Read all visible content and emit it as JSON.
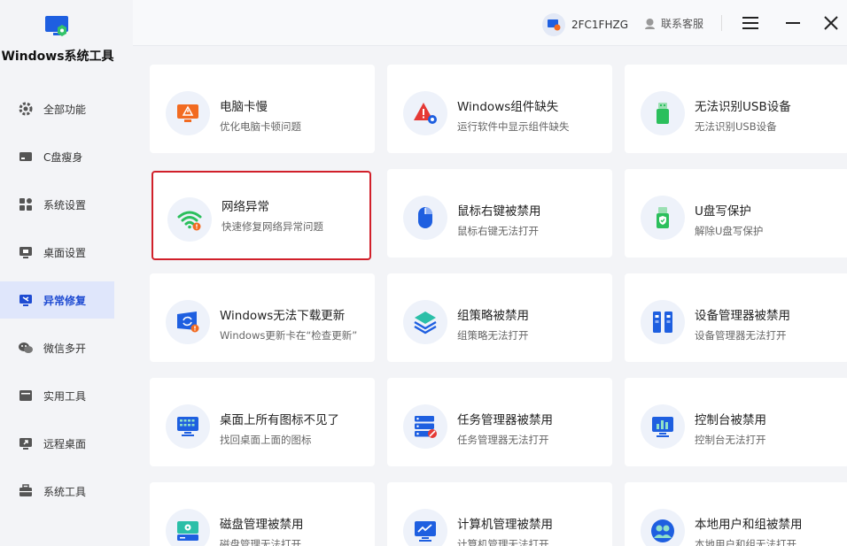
{
  "app": {
    "title": "Windows系统工具"
  },
  "sidebar": {
    "items": [
      {
        "label": "全部功能",
        "icon": "gear-icon"
      },
      {
        "label": "C盘瘦身",
        "icon": "drive-icon"
      },
      {
        "label": "系统设置",
        "icon": "grid-icon"
      },
      {
        "label": "桌面设置",
        "icon": "monitor-icon"
      },
      {
        "label": "异常修复",
        "icon": "repair-icon",
        "active": true
      },
      {
        "label": "微信多开",
        "icon": "wechat-icon"
      },
      {
        "label": "实用工具",
        "icon": "toolbox-icon"
      },
      {
        "label": "远程桌面",
        "icon": "remote-icon"
      },
      {
        "label": "系统工具",
        "icon": "briefcase-icon"
      }
    ]
  },
  "header": {
    "user_id": "2FC1FHZG",
    "support_label": "联系客服"
  },
  "cards": [
    {
      "title": "电脑卡慢",
      "desc": "优化电脑卡顿问题",
      "icon": "slow-pc-icon"
    },
    {
      "title": "Windows组件缺失",
      "desc": "运行软件中显示组件缺失",
      "icon": "component-warning-icon"
    },
    {
      "title": "无法识别USB设备",
      "desc": "无法识别USB设备",
      "icon": "usb-icon"
    },
    {
      "title": "网络异常",
      "desc": "快速修复网络异常问题",
      "icon": "wifi-warning-icon",
      "highlight": true
    },
    {
      "title": "鼠标右键被禁用",
      "desc": "鼠标右键无法打开",
      "icon": "mouse-icon"
    },
    {
      "title": "U盘写保护",
      "desc": "解除U盘写保护",
      "icon": "usb-shield-icon"
    },
    {
      "title": "Windows无法下载更新",
      "desc": "Windows更新卡在“检查更新”",
      "icon": "update-icon"
    },
    {
      "title": "组策略被禁用",
      "desc": "组策略无法打开",
      "icon": "layers-icon"
    },
    {
      "title": "设备管理器被禁用",
      "desc": "设备管理器无法打开",
      "icon": "device-manager-icon"
    },
    {
      "title": "桌面上所有图标不见了",
      "desc": "找回桌面上面的图标",
      "icon": "desktop-icons-icon"
    },
    {
      "title": "任务管理器被禁用",
      "desc": "任务管理器无法打开",
      "icon": "task-manager-icon"
    },
    {
      "title": "控制台被禁用",
      "desc": "控制台无法打开",
      "icon": "console-icon"
    },
    {
      "title": "磁盘管理被禁用",
      "desc": "磁盘管理无法打开",
      "icon": "disk-icon"
    },
    {
      "title": "计算机管理被禁用",
      "desc": "计算机管理无法打开",
      "icon": "computer-management-icon"
    },
    {
      "title": "本地用户和组被禁用",
      "desc": "本地用户和组无法打开",
      "icon": "users-icon"
    }
  ],
  "colors": {
    "accent": "#1e4bd2",
    "highlight": "#d1202a",
    "orange": "#f26b21",
    "green": "#2bbf5c"
  }
}
